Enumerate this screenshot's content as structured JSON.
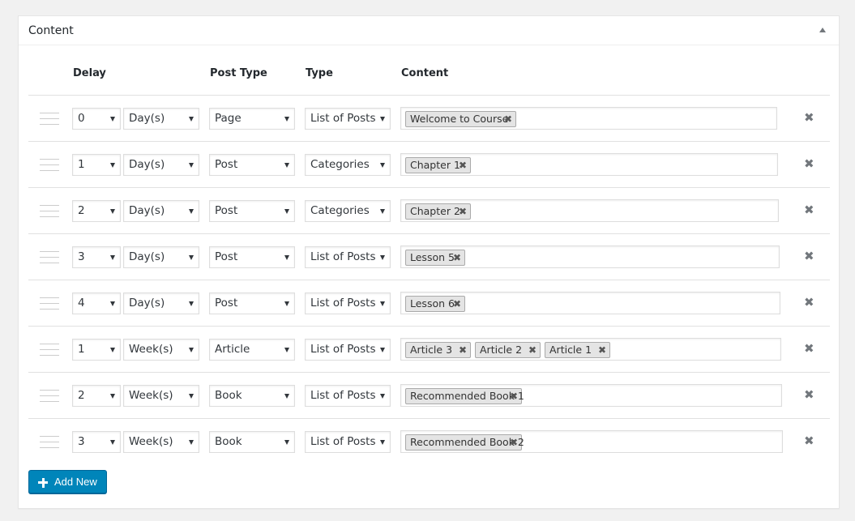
{
  "panel": {
    "title": "Content"
  },
  "columns": {
    "delay": "Delay",
    "post_type": "Post Type",
    "type": "Type",
    "content": "Content"
  },
  "rows": [
    {
      "delay": "0",
      "unit": "Day(s)",
      "post_type": "Page",
      "type": "List of Posts",
      "items": [
        "Welcome to Course"
      ]
    },
    {
      "delay": "1",
      "unit": "Day(s)",
      "post_type": "Post",
      "type": "Categories",
      "items": [
        "Chapter 1"
      ]
    },
    {
      "delay": "2",
      "unit": "Day(s)",
      "post_type": "Post",
      "type": "Categories",
      "items": [
        "Chapter 2"
      ]
    },
    {
      "delay": "3",
      "unit": "Day(s)",
      "post_type": "Post",
      "type": "List of Posts",
      "items": [
        "Lesson 5"
      ]
    },
    {
      "delay": "4",
      "unit": "Day(s)",
      "post_type": "Post",
      "type": "List of Posts",
      "items": [
        "Lesson 6"
      ]
    },
    {
      "delay": "1",
      "unit": "Week(s)",
      "post_type": "Article",
      "type": "List of Posts",
      "items": [
        "Article 3",
        "Article 2",
        "Article 1"
      ]
    },
    {
      "delay": "2",
      "unit": "Week(s)",
      "post_type": "Book",
      "type": "List of Posts",
      "items": [
        "Recommended Book 1"
      ]
    },
    {
      "delay": "3",
      "unit": "Week(s)",
      "post_type": "Book",
      "type": "List of Posts",
      "items": [
        "Recommended Book 2"
      ]
    }
  ],
  "actions": {
    "add_new": "Add New",
    "remove_glyph": "✖",
    "chip_remove_glyph": "✖"
  },
  "colors": {
    "primary_button": "#0085ba",
    "chip_bg": "#e4e4e4",
    "border": "#dddddd"
  }
}
